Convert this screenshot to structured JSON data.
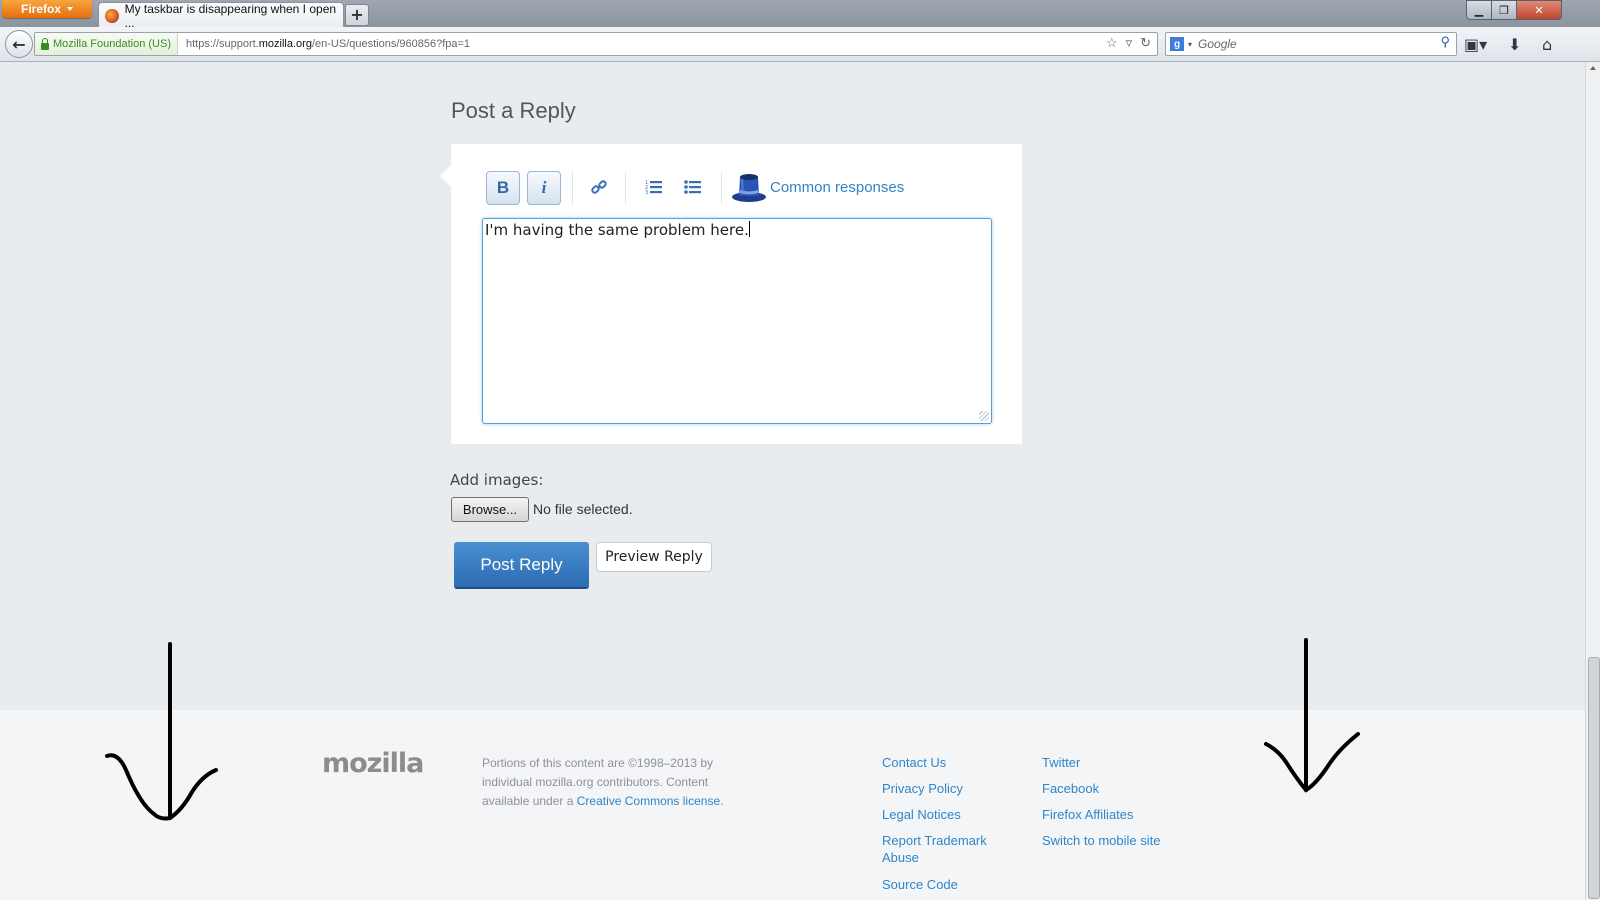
{
  "browser": {
    "firefox_label": "Firefox",
    "tab_title": "My taskbar is disappearing when I open ...",
    "new_tab": "+",
    "window_controls": {
      "minimize": "▁",
      "maximize": "❐",
      "close": "✕"
    },
    "identity": "Mozilla Foundation (US)",
    "url_prefix": "https://support.",
    "url_domain": "mozilla.org",
    "url_path": "/en-US/questions/960856?fpa=1",
    "search_placeholder": "Google"
  },
  "reply": {
    "heading": "Post a Reply",
    "toolbar": {
      "bold": "B",
      "italic": "i",
      "common_responses": "Common responses"
    },
    "editor_text": "I'm having the same problem here.",
    "add_images_label": "Add images:",
    "browse_label": "Browse...",
    "no_file": "No file selected.",
    "post_button": "Post Reply",
    "preview_button": "Preview Reply"
  },
  "footer": {
    "logo": "mozilla",
    "copyright_text": "Portions of this content are ©1998–2013 by individual mozilla.org contributors. Content available under a ",
    "license_link": "Creative Commons license",
    "license_end": ".",
    "links_col1": [
      "Contact Us",
      "Privacy Policy",
      "Legal Notices",
      "Report Trademark Abuse",
      "Source Code"
    ],
    "links_col2": [
      "Twitter",
      "Facebook",
      "Firefox Affiliates",
      "Switch to mobile site"
    ]
  },
  "colors": {
    "accent": "#2e86c9",
    "post_button": "#3a7dc4",
    "page_bg": "#e9ecef"
  }
}
